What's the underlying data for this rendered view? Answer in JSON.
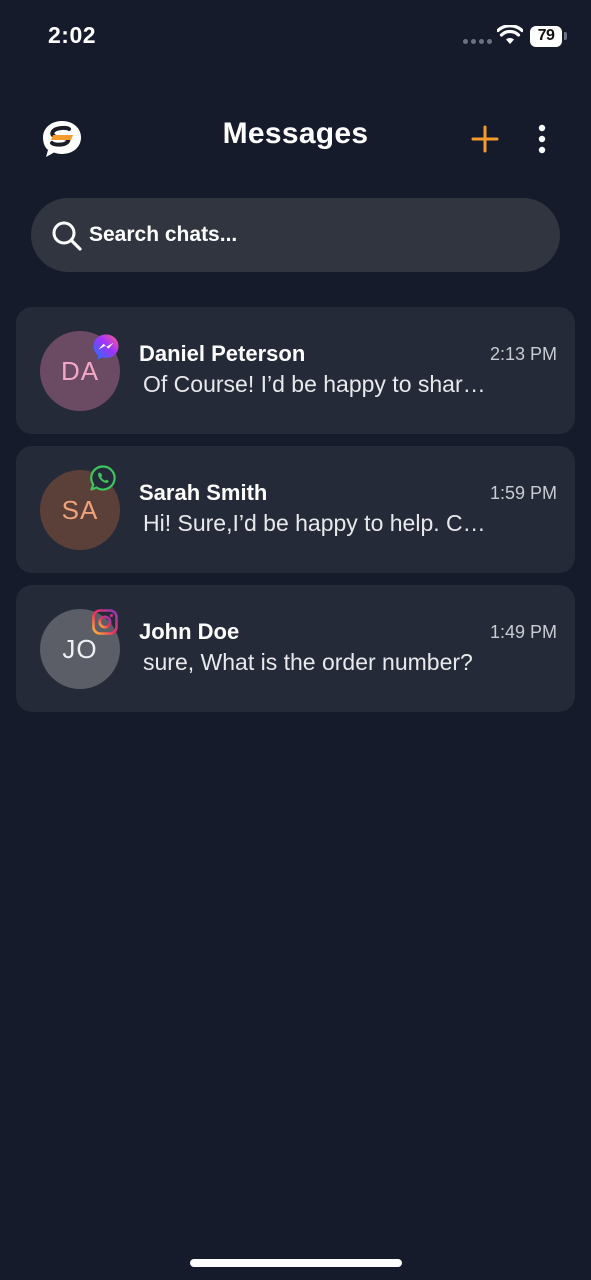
{
  "status_bar": {
    "time": "2:02",
    "battery": "79"
  },
  "header": {
    "title": "Messages",
    "logo_icon": "chat-bubble-logo-icon",
    "add_icon": "plus-icon",
    "more_icon": "vertical-dots-icon"
  },
  "search": {
    "placeholder": "Search chats...",
    "value": ""
  },
  "chats": [
    {
      "initials": "DA",
      "name": "Daniel Peterson",
      "time": "2:13 PM",
      "preview": "Of Course! I’d be happy to share more details about our products.",
      "platform": "messenger-icon",
      "avatar_bg": "#6b4a63",
      "initials_color": "#f3a7c7"
    },
    {
      "initials": "SA",
      "name": "Sarah Smith",
      "time": "1:59 PM",
      "preview": "Hi! Sure,I’d be happy to help. Could you tell me more?",
      "platform": "whatsapp-icon",
      "avatar_bg": "#5a4039",
      "initials_color": "#f0a27a"
    },
    {
      "initials": "JO",
      "name": "John Doe",
      "time": "1:49 PM",
      "preview": "sure, What is the order number?",
      "platform": "instagram-icon",
      "avatar_bg": "#5b5d67",
      "initials_color": "#eef0f3"
    }
  ],
  "colors": {
    "background": "#161b2c",
    "card": "#252a38",
    "search_bg": "#30353f",
    "accent": "#f59a2c"
  }
}
